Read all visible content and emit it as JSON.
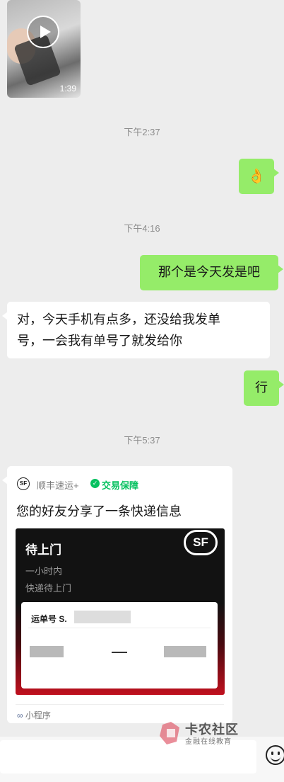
{
  "video": {
    "duration": "1:39"
  },
  "messages": {
    "time1": "下午2:37",
    "ok_emoji": "👌",
    "time2": "下午4:16",
    "msg1": "那个是今天发是吧",
    "msg2_line1": "对，今天手机有点多，还没给我发单",
    "msg2_line2": "号，一会我有单号了就发给你",
    "msg3": "行",
    "time3": "下午5:37"
  },
  "card": {
    "logo_text": "SF",
    "source": "顺丰速运+",
    "guarantee": "交易保障",
    "title": "您的好友分享了一条快递信息",
    "status_title": "待上门",
    "status_sub1": "一小时内",
    "status_sub2": "快递待上门",
    "brand": "SF",
    "waybill_label": "运单号 S.",
    "footer": "小程序"
  },
  "watermark": {
    "name": "卡农社区",
    "tagline": "金融在线教育"
  },
  "colors": {
    "bubble_green": "#95ec69",
    "wechat_green": "#07c160",
    "sf_red": "#e4202d",
    "chat_bg": "#ededed"
  },
  "icons": [
    "play-icon",
    "sf-logo-icon",
    "shield-check-icon",
    "mini-program-icon",
    "emoji-icon"
  ]
}
